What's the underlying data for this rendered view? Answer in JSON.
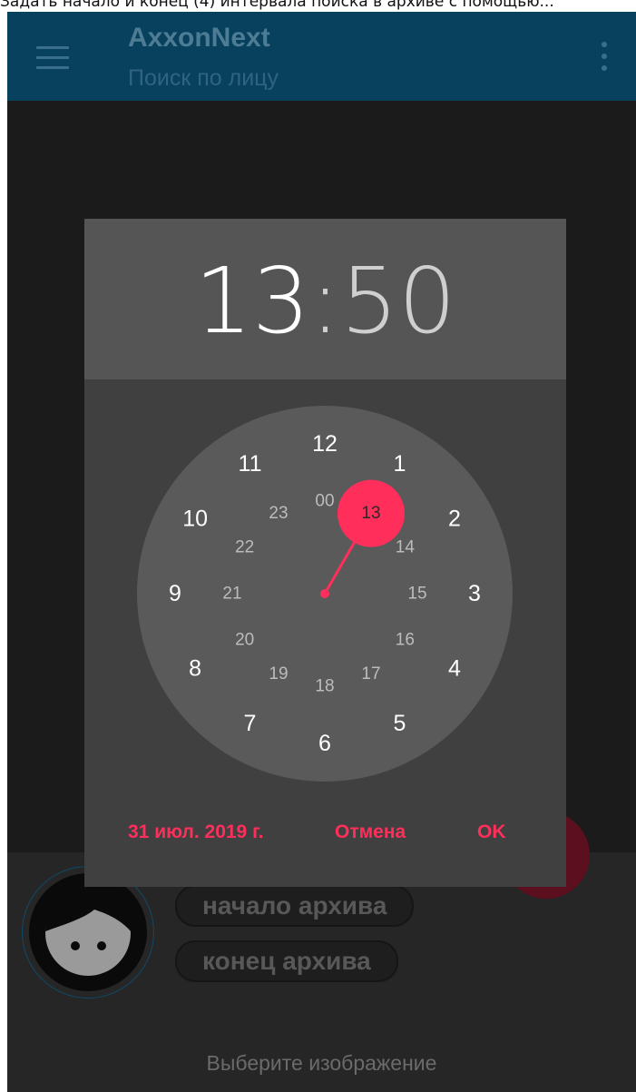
{
  "caption": "Задать начало и конец (4) интервала поиска в архиве с помощью...",
  "appbar": {
    "menu_icon": "hamburger-menu-icon",
    "title": "AxxonNext",
    "subtitle": "Поиск по лицу",
    "overflow_icon": "more-vert-icon",
    "color": "#08415e"
  },
  "time_picker": {
    "hour": "13",
    "separator": ":",
    "minute": "50",
    "selected_hour": "13",
    "outer_hours": [
      "12",
      "1",
      "2",
      "3",
      "4",
      "5",
      "6",
      "7",
      "8",
      "9",
      "10",
      "11"
    ],
    "inner_hours": [
      "00",
      "13",
      "14",
      "15",
      "16",
      "17",
      "18",
      "19",
      "20",
      "21",
      "22",
      "23"
    ],
    "accent": "#ff2e5a",
    "buttons": {
      "date": "31 июл. 2019 г.",
      "cancel": "Отмена",
      "ok": "OK"
    }
  },
  "search_panel": {
    "avatar_icon": "face-avatar-icon",
    "start_label": "начало архива",
    "end_label": "конец архива",
    "hint": "Выберите изображение"
  }
}
